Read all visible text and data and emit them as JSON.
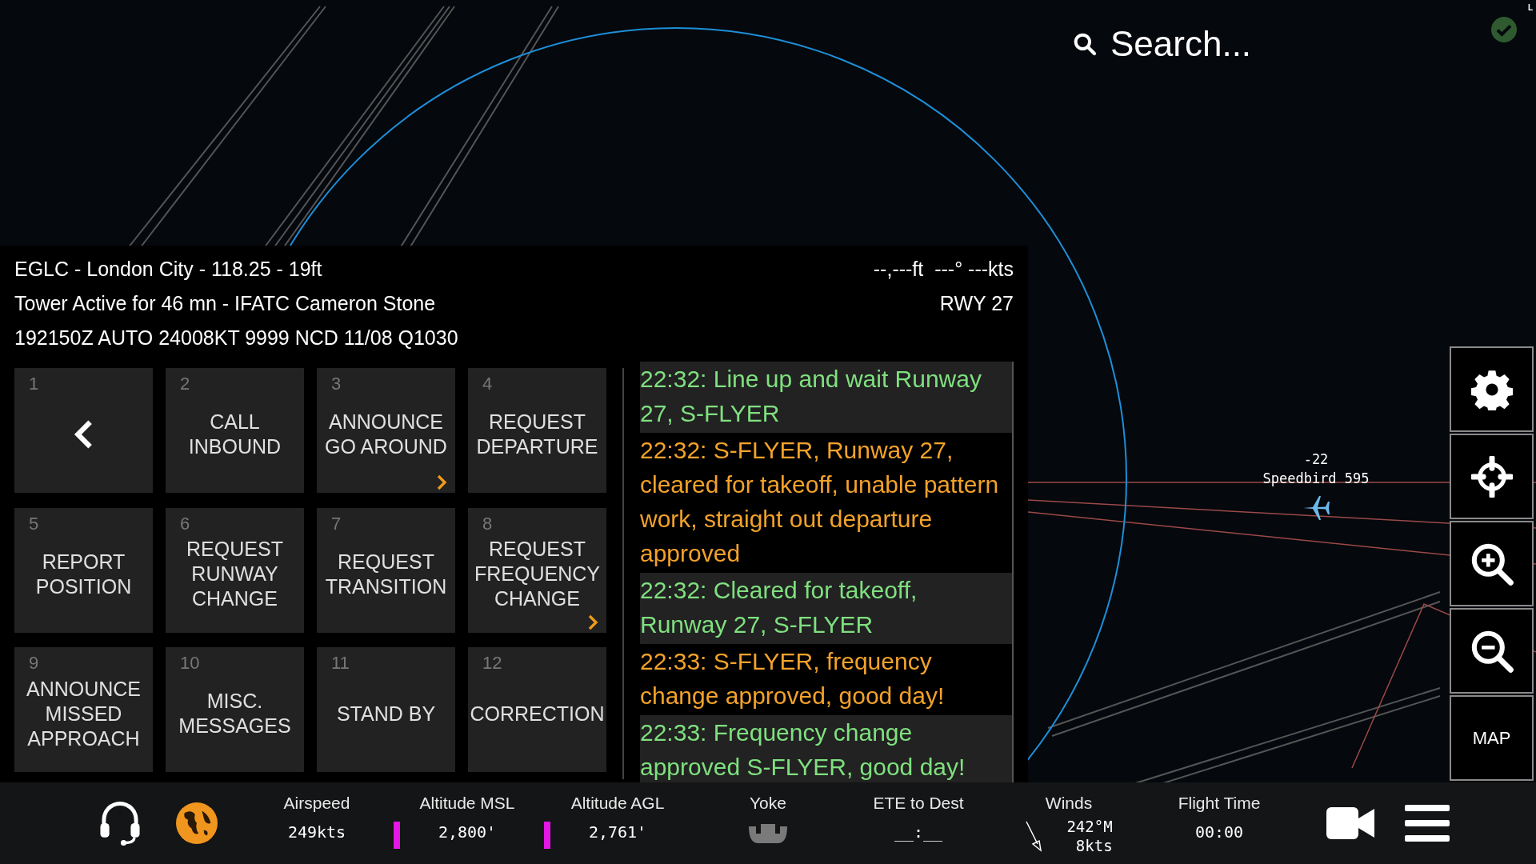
{
  "search": {
    "placeholder": "Search..."
  },
  "status": {
    "ok": true,
    "corner_label": "L"
  },
  "map": {
    "traffic": [
      {
        "altitude": "-22",
        "callsign": "Speedbird 595"
      }
    ]
  },
  "atc_panel": {
    "station": "EGLC - London City - 118.25 - 19ft",
    "readout": "--,---ft  ---° ---kts",
    "controller": "Tower Active for 46 mn - IFATC Cameron Stone",
    "runway": "RWY 27",
    "metar": "192150Z AUTO 24008KT 9999 NCD 11/08 Q1030",
    "buttons": [
      {
        "number": "1",
        "kind": "back",
        "submenu": false
      },
      {
        "number": "2",
        "kind": "text",
        "label": "CALL INBOUND",
        "submenu": false
      },
      {
        "number": "3",
        "kind": "text",
        "label": "ANNOUNCE GO AROUND",
        "submenu": true
      },
      {
        "number": "4",
        "kind": "text",
        "label": "REQUEST DEPARTURE",
        "submenu": false
      },
      {
        "number": "5",
        "kind": "text",
        "label": "REPORT POSITION",
        "submenu": false
      },
      {
        "number": "6",
        "kind": "text",
        "label": "REQUEST RUNWAY CHANGE",
        "submenu": false
      },
      {
        "number": "7",
        "kind": "text",
        "label": "REQUEST TRANSITION",
        "submenu": false
      },
      {
        "number": "8",
        "kind": "text",
        "label": "REQUEST FREQUENCY CHANGE",
        "submenu": true
      },
      {
        "number": "9",
        "kind": "text",
        "label": "ANNOUNCE MISSED APPROACH",
        "submenu": false
      },
      {
        "number": "10",
        "kind": "text",
        "label": "MISC. MESSAGES",
        "submenu": false
      },
      {
        "number": "11",
        "kind": "text",
        "label": "STAND BY",
        "submenu": false
      },
      {
        "number": "12",
        "kind": "text",
        "label": "CORRECTION",
        "submenu": false
      }
    ],
    "messages": [
      {
        "kind": "pilot",
        "text": "22:32: Line up and wait Runway 27, S-FLYER"
      },
      {
        "kind": "atc",
        "text": "22:32: S-FLYER, Runway 27, cleared for takeoff, unable pattern work, straight out departure approved"
      },
      {
        "kind": "pilot",
        "text": "22:32: Cleared for takeoff, Runway 27, S-FLYER"
      },
      {
        "kind": "atc",
        "text": "22:33: S-FLYER, frequency change approved, good day!"
      },
      {
        "kind": "pilot",
        "text": "22:33: Frequency change approved S-FLYER, good day!"
      }
    ]
  },
  "side_buttons": [
    {
      "kind": "settings"
    },
    {
      "kind": "locate"
    },
    {
      "kind": "zoom_in"
    },
    {
      "kind": "zoom_out"
    },
    {
      "kind": "text",
      "label": "MAP"
    }
  ],
  "bottom_bar": {
    "items": [
      {
        "kind": "reading",
        "label": "Airspeed",
        "value": "249kts",
        "bar": false
      },
      {
        "kind": "reading",
        "label": "Altitude MSL",
        "value": "2,800'",
        "bar": true
      },
      {
        "kind": "reading",
        "label": "Altitude AGL",
        "value": "2,761'",
        "bar": true
      },
      {
        "kind": "yoke",
        "label": "Yoke"
      },
      {
        "kind": "reading",
        "label": "ETE to Dest",
        "value": "__:__",
        "bar": false
      },
      {
        "kind": "winds",
        "label": "Winds",
        "direction": "242°M",
        "speed": "8kts"
      },
      {
        "kind": "reading",
        "label": "Flight Time",
        "value": "00:00",
        "bar": false
      }
    ]
  }
}
